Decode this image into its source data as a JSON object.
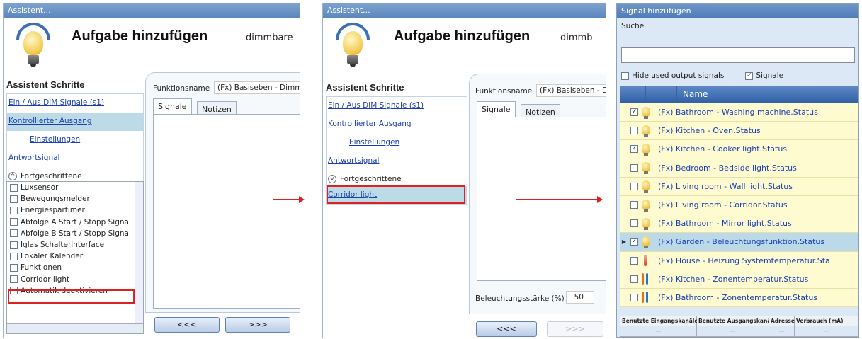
{
  "p1": {
    "title": "Assistent...",
    "heading": "Aufgabe hinzufügen",
    "subheading": "dimmbare",
    "steps_title": "Assistent Schritte",
    "steps": [
      "Ein / Aus DIM Signale (s1)",
      "Kontrollierter Ausgang",
      "Einstellungen",
      "Antwortsignal"
    ],
    "advanced": "Fortgeschrittene",
    "checklist": [
      "Luxsensor",
      "Bewegungsmelder",
      "Energiespartimer",
      "Abfolge A Start / Stopp Signal",
      "Abfolge B Start / Stopp Signal",
      "Iglas Schalterinterface",
      "Lokaler Kalender",
      "Funktionen",
      "Corridor light",
      "Automatik deaktivieren"
    ],
    "function_label": "Funktionsname",
    "function_value": "(Fx) Basiseben - Dimmb",
    "tabs": [
      "Signale",
      "Notizen"
    ],
    "prev": "<<<",
    "next": ">>>"
  },
  "p2": {
    "title": "Assistent...",
    "heading": "Aufgabe hinzufügen",
    "subheading": "dimmb",
    "steps_title": "Assistent Schritte",
    "steps": [
      "Ein / Aus DIM Signale (s1)",
      "Kontrollierter Ausgang",
      "Einstellungen",
      "Antwortsignal"
    ],
    "advanced": "Fortgeschrittene",
    "extra_step": "Corridor light",
    "function_label": "Funktionsname",
    "function_value": "(Fx) Basiseben - D",
    "tabs": [
      "Signale",
      "Notizen"
    ],
    "brightness_label": "Beleuchtungsstärke (%)",
    "brightness_value": "50",
    "prev": "<<<",
    "next": ">>>"
  },
  "p3": {
    "title": "Signal hinzufügen",
    "search_label": "Suche",
    "hide_used": "Hide used output signals",
    "signale": "Signale",
    "col_name": "Name",
    "rows": [
      {
        "name": "(Fx) Bathroom - Washing machine.Status",
        "checked": true,
        "icon": "bulb-icon"
      },
      {
        "name": "(Fx) Kitchen - Oven.Status",
        "checked": false,
        "icon": "bulb-icon"
      },
      {
        "name": "(Fx) Kitchen - Cooker light.Status",
        "checked": true,
        "icon": "bulb-icon"
      },
      {
        "name": "(Fx) Bedroom - Bedside light.Status",
        "checked": false,
        "icon": "bulb-icon"
      },
      {
        "name": "(Fx) Living room - Wall light.Status",
        "checked": false,
        "icon": "bulb-icon"
      },
      {
        "name": "(Fx) Living room - Corridor.Status",
        "checked": false,
        "icon": "bulb-icon"
      },
      {
        "name": "(Fx) Bathroom - Mirror light.Status",
        "checked": false,
        "icon": "bulb-icon"
      },
      {
        "name": "(Fx) Garden - Beleuchtungsfunktion.Status",
        "checked": true,
        "icon": "bulb-icon",
        "selected": true
      },
      {
        "name": "(Fx) House - Heizung Systemtemperatur.Sta",
        "checked": false,
        "icon": "thermometer-icon"
      },
      {
        "name": "(Fx) Kitchen - Zonentemperatur.Status",
        "checked": false,
        "icon": "zone-temperature-icon"
      },
      {
        "name": "(Fx) Bathroom - Zonentemperatur.Status",
        "checked": false,
        "icon": "zone-temperature-icon"
      }
    ],
    "footer_headers": [
      "Benutzte Eingangskanäle",
      "Benutzte Ausgangskanäle",
      "Adresse",
      "Verbrauch (mA)"
    ],
    "footer_values": [
      "---",
      "---",
      "---",
      "---"
    ]
  }
}
